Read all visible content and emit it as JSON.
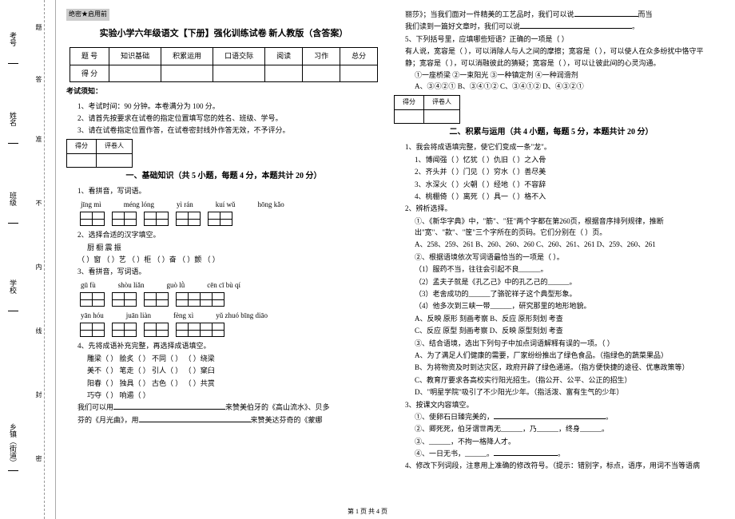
{
  "secret": "绝密★启用前",
  "title": "实验小学六年级语文【下册】强化训练试卷 新人教版（含答案）",
  "score_header": [
    "题 号",
    "知识基础",
    "积累运用",
    "口语交际",
    "阅读",
    "习作",
    "总分"
  ],
  "score_row2": "得 分",
  "notice_head": "考试须知：",
  "notice": [
    "1、考试时间：90 分钟。本卷满分为 100 分。",
    "2、请首先按要求在试卷的指定位置填写您的姓名、班级、学号。",
    "3、请在试卷指定位置作答，在试卷密封线外作答无效，不予评分。"
  ],
  "mini": {
    "a": "得分",
    "b": "评卷人"
  },
  "part1_title": "一、基础知识（共 5 小题，每题 4 分，本题共计 20 分）",
  "q1": "1、看拼音，写词语。",
  "pinyin1": [
    "jīng  mì",
    "méng  lóng",
    "yì  rán",
    "kuí  wǔ",
    "hōng  kǎo"
  ],
  "grid1_sizes": [
    2,
    2,
    2,
    2,
    2
  ],
  "q2": "2、选择合适的汉字填空。",
  "q2_line1": "厨    橱    震    振",
  "q2_line2": "（  ）窗 （  ）艺 （  ）柜    （  ）奋 （  ）颤 （  ）",
  "q3": "3、看拼音，写词语。",
  "pinyin2a": [
    "gū  fù",
    "shòu liǎn",
    "guò  lǜ",
    "cēn  cī  bù  qí"
  ],
  "grid2a_sizes": [
    2,
    2,
    2,
    4
  ],
  "pinyin2b": [
    "yān  hóu",
    "juān liàn",
    "fèng  xì",
    "yǔ zhuó bīng diāo"
  ],
  "grid2b_sizes": [
    2,
    2,
    2,
    4
  ],
  "q4": "4、先将成语补充完整，再选择成语填空。",
  "q4_rows": [
    "雕梁（  ）    脍炙（  ）    不同（  ）    （  ）绕梁",
    "美不（  ）    笔走（  ）    引人（  ）    （  ）窠臼",
    "阳春（  ）    独具（  ）    古色（  ）    （  ）共赏",
    "巧夺（  ）    响遏（  ）"
  ],
  "q4_text1": "我们可以用",
  "q4_text2": "来赞美伯牙的《高山流水》、贝多",
  "q4_text3": "芬的《月光曲》，用",
  "q4_text4": "来赞美达芬奇的《蒙娜",
  "r_top1": "丽莎》；当我们面对一件精美的工艺品时，我们可以说",
  "r_top2": "而当",
  "r_top3": "我们读到一篇好文章时，我们可以说",
  "q5": "5、下列括号里，应填哪些短语？正确的一项是（   ）",
  "q5_body": "有人说，宽容是（   ），可以消除人与人之间的摩擦；宽容是（   ），可以使人在众多纷扰中恪守平静；宽容是（   ），可以消融彼此的猜疑；宽容是（   ），可以让彼此间的心灵沟通。",
  "q5_opts_line": "①一座桥梁    ②一束阳光    ③一种镇定剂    ④一种润滑剂",
  "q5_choices": "A、③④②①    B、③④①②    C、③④①②    D、④③②①",
  "part2_title": "二、积累与运用（共 4 小题，每题 5 分，本题共计 20 分）",
  "p2_q1": "1、我会将成语填完整，使它们变成一条\"龙\"。",
  "p2_q1_rows": [
    "1、博闻强（ ）忆犹（ ）仇旧（ ）之入骨",
    "2、齐头并（ ）门见（ ）穷水（ ）善尽美",
    "3、水深火（ ）火朝（ ）经地（ ）不容辞",
    "4、桃棚倚（ ）离死（ ）具一（ ）格不入"
  ],
  "p2_q2": "2、辨析选择。",
  "p2_q2_1": "①、《新华字典》中，\"筋\"、\"狂\"两个字都在第260页，根据音序排列规律，推断出\"宽\"、\"款\"、\"筐\"三个字所在的页码。它们分别在（    ）页。",
  "p2_q2_1_opts": "A、258、259、261  B、260、260、260  C、260、261、261  D、259、260、261",
  "p2_q2_2": "②、根据语境依次写词语最恰当的一项是（    ）。",
  "p2_q2_2_lines": [
    "（1）服药不当，往往会引起不良______。",
    "（2）孟夫子就是《孔乙己》中的孔乙己的______。",
    "（3）老舍成功的______了骆驼祥子这个典型形象。",
    "（4）他多次到三峡一带______，研究那里的地形地貌。"
  ],
  "p2_q2_2_opts": [
    "A、反映  原形  刻画考察    B、反应  原形刻划 考查",
    "C、反应  原型  刻画考察    D、反映  原型刻划 考查"
  ],
  "p2_q2_3": "③、结合语境，选出下列句子中加点词语解释有误的一项。（   ）",
  "p2_q2_3_lines": [
    "A、为了满足人们健康的需要，厂家纷纷推出了绿色食品。（指绿色的蔬菜果品）",
    "B、为将物资及时到达灾区，政府开辟了绿色通道。（指方便快捷的途径、优惠政策等）",
    "C、教育厅要求各高校实行阳光招生。（指公开、公平、公正的招生）",
    "D、\"明星学院\"吸引了不少阳光少年。（指活泼、富有生气的少年）"
  ],
  "p2_q3": "3、按课文内容填空。",
  "p2_q3_lines": [
    "①、使卵石日臻完美的，",
    "②、卿死死，伯牙谓世再无______，乃______，终身______。",
    "③、______，不拘一格降人才。",
    "④、一日无书，______。"
  ],
  "p2_q4": "4、修改下列词段，注意用上准确的修改符号。（提示：错别字，标点，语序，用词不当等语病",
  "margins": {
    "l1": "考号",
    "l2": "姓名",
    "l3": "班级",
    "l4": "学校",
    "l5": "乡镇（街道）",
    "v1": "题",
    "v2": "答",
    "v3": "准",
    "v4": "不",
    "v5": "内",
    "v6": "线",
    "v7": "封",
    "v8": "密"
  },
  "footer": "第 1 页 共 4 页"
}
